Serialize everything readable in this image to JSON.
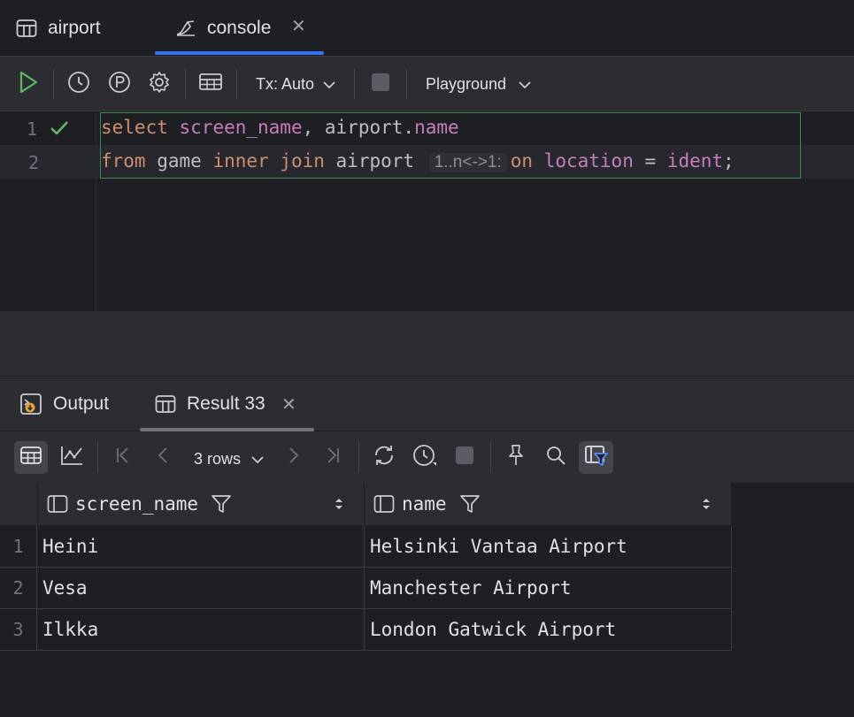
{
  "tabs": [
    {
      "label": "airport",
      "icon": "table-icon"
    },
    {
      "label": "console",
      "icon": "sql-console-icon",
      "close": "✕"
    }
  ],
  "toolbar": {
    "tx_label": "Tx: Auto",
    "playground_label": "Playground"
  },
  "editor": {
    "lines": [
      {
        "number": "1",
        "tokens": {
          "select": "select",
          "f1": "screen_name",
          "p1": ", ",
          "t1": "airport",
          "dot": ".",
          "f2": "name"
        }
      },
      {
        "number": "2",
        "tokens": {
          "from": "from",
          "t1": " game ",
          "inner": "inner",
          "join": "join",
          "t2": " airport ",
          "hint": "1..n<->1:",
          "on": "on",
          "f1": "location",
          "eq": " = ",
          "f2": "ident",
          "semi": ";"
        }
      }
    ]
  },
  "panel_tabs": [
    {
      "label": "Output",
      "icon": "output-icon"
    },
    {
      "label": "Result 33",
      "icon": "table-icon",
      "close": "✕"
    }
  ],
  "result_toolbar": {
    "rows_label": "3 rows"
  },
  "table": {
    "columns": [
      {
        "label": "screen_name"
      },
      {
        "label": "name"
      }
    ],
    "rows": [
      {
        "num": "1",
        "cells": [
          "Heini",
          "Helsinki Vantaa Airport"
        ]
      },
      {
        "num": "2",
        "cells": [
          "Vesa",
          "Manchester Airport"
        ]
      },
      {
        "num": "3",
        "cells": [
          "Ilkka",
          "London Gatwick Airport"
        ]
      }
    ]
  },
  "colors": {
    "keyword": "#cf8e6d",
    "field": "#c77dbb",
    "run_green": "#5fb865",
    "accent": "#3574f0"
  }
}
